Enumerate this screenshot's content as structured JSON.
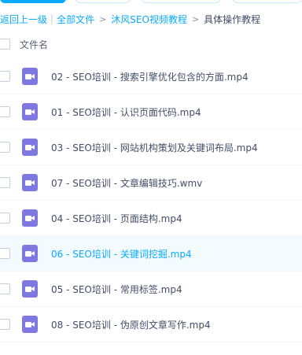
{
  "breadcrumb": {
    "back": "返回上一级",
    "divider": "|",
    "all_files": "全部文件",
    "sep": ">",
    "folder": "沐风SEO视频教程",
    "current": "具体操作教程"
  },
  "header": {
    "column_label": "文件名"
  },
  "files": [
    {
      "name": "02 - SEO培训 - 搜索引擎优化包含的方面.mp4",
      "icon": "video-file-icon",
      "highlighted": false
    },
    {
      "name": "01 - SEO培训 - 认识页面代码.mp4",
      "icon": "video-file-icon",
      "highlighted": false
    },
    {
      "name": "03 - SEO培训 - 网站机构策划及关键词布局.mp4",
      "icon": "video-file-icon",
      "highlighted": false
    },
    {
      "name": "07 - SEO培训 - 文章编辑技巧.wmv",
      "icon": "video-file-icon",
      "highlighted": false
    },
    {
      "name": "04 - SEO培训 - 页面结构.mp4",
      "icon": "video-file-icon",
      "highlighted": false
    },
    {
      "name": "06 - SEO培训 - 关键词挖掘.mp4",
      "icon": "video-file-icon",
      "highlighted": true
    },
    {
      "name": "05 - SEO培训 - 常用标签.mp4",
      "icon": "video-file-icon",
      "highlighted": false
    },
    {
      "name": "08 - SEO培训 - 伪原创文章写作.mp4",
      "icon": "video-file-icon",
      "highlighted": false
    }
  ],
  "colors": {
    "accent": "#09aaff",
    "text": "#424e67",
    "video_icon": "#7f78e0",
    "row_highlight": "#f4fbff"
  }
}
